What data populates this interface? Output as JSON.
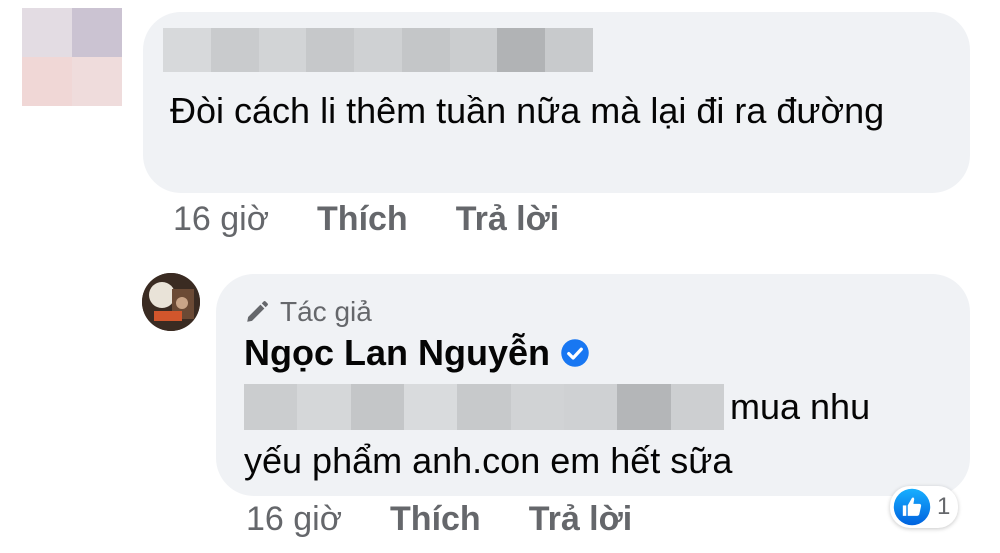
{
  "comment1": {
    "text": "Đòi cách li thêm tuần nữa mà lại đi ra đường",
    "time": "16 giờ",
    "like_label": "Thích",
    "reply_label": "Trả lời"
  },
  "comment2": {
    "author_badge": "Tác giả",
    "author_name": "Ngọc Lan Nguyễn",
    "text_line1": "mua nhu",
    "text_line2": "yếu phẩm anh.con em hết sữa",
    "time": "16 giờ",
    "like_label": "Thích",
    "reply_label": "Trả lời",
    "reaction_count": "1"
  },
  "colors": {
    "bubble": "#f0f2f5",
    "secondary_text": "#65676b",
    "facebook_blue": "#1877f2"
  }
}
